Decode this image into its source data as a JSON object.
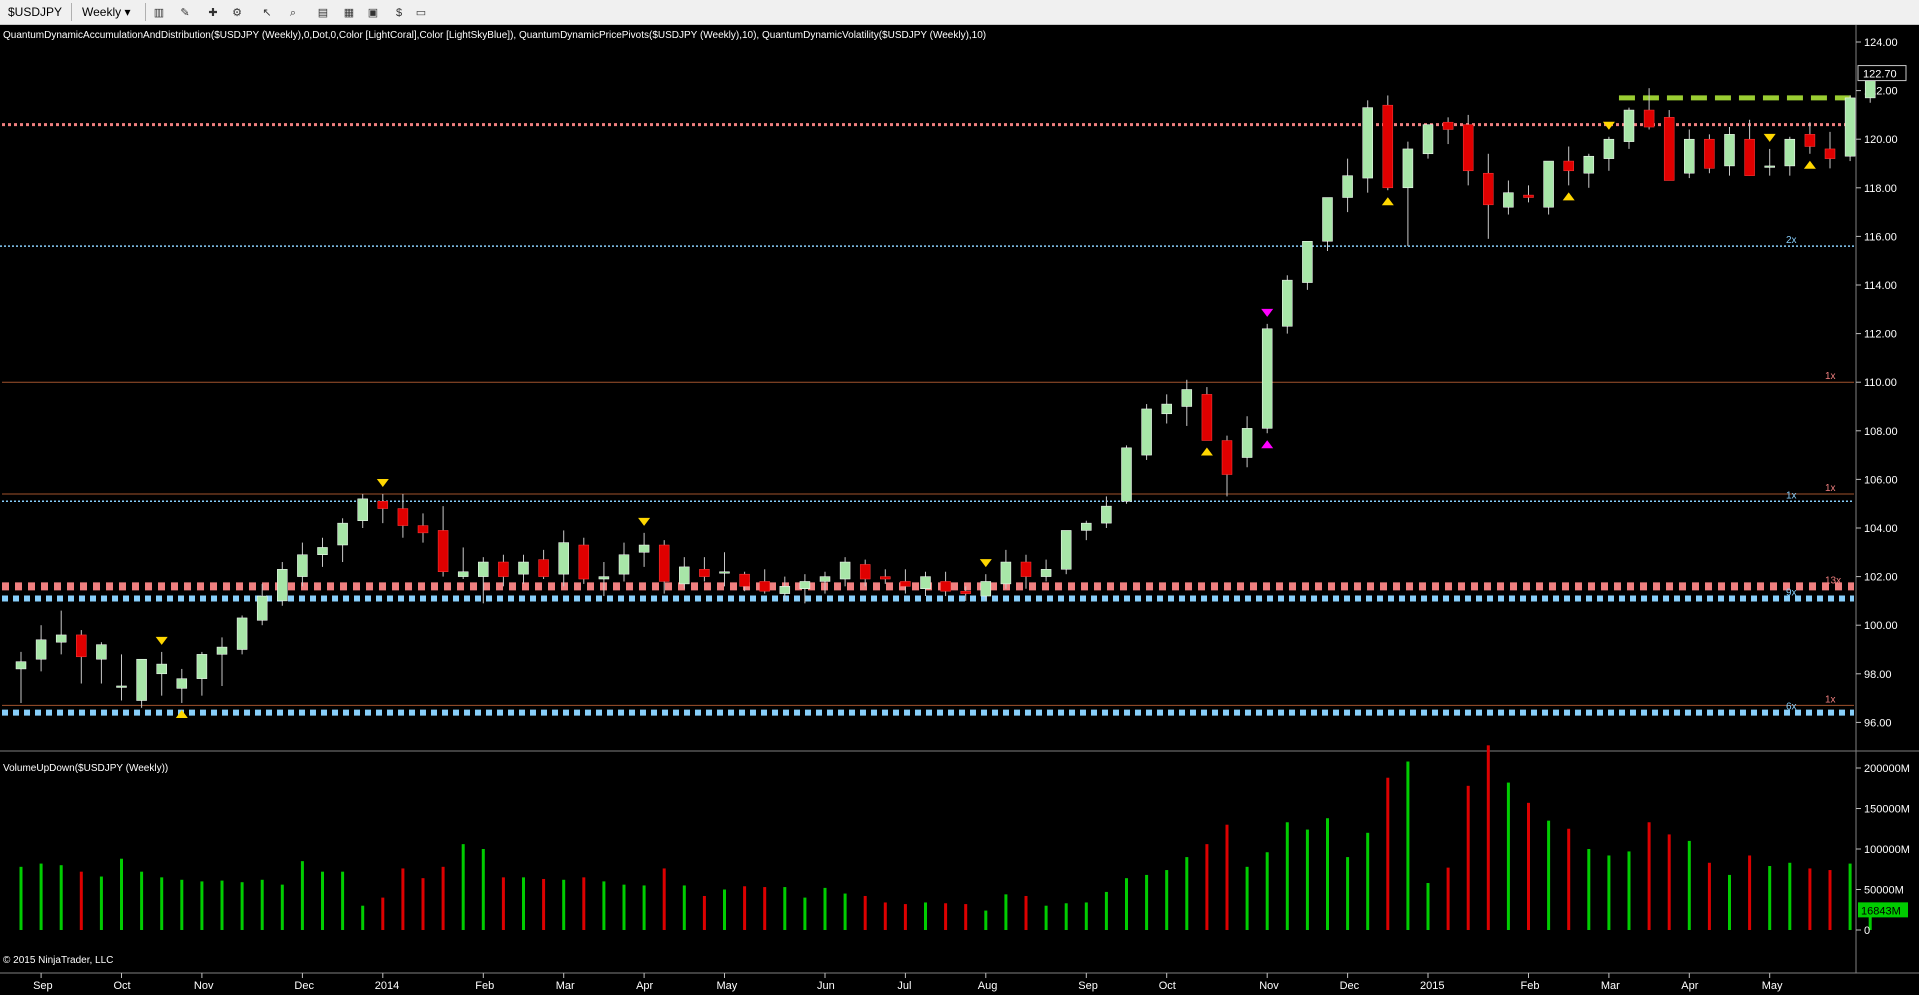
{
  "toolbar": {
    "instrument": "$USDJPY",
    "interval": "Weekly",
    "icons": [
      "bar-style-icon",
      "draw-pencil-icon",
      "indicator-icon",
      "strategy-icon",
      "cursor-icon",
      "zoom-icon",
      "data-box-icon",
      "chart-trader-icon",
      "properties-icon",
      "price-marker-icon",
      "window-icon"
    ]
  },
  "indicator_label": "QuantumDynamicAccumulationAndDistribution($USDJPY (Weekly),0,Dot,0,Color [LightCoral],Color [LightSkyBlue]), QuantumDynamicPricePivots($USDJPY (Weekly),10), QuantumDynamicVolatility($USDJPY (Weekly),10)",
  "volume_label": "VolumeUpDown($USDJPY (Weekly))",
  "copyright": "© 2015 NinjaTrader, LLC",
  "colors": {
    "up": "#a8e6a8",
    "down": "#e00000",
    "vol_up": "#00cc00",
    "vol_down": "#dd0000",
    "coral": "#f08080",
    "skyblue": "#87cefa",
    "pivot": "#ffd700",
    "pivot_alt": "#ff00ff",
    "resistance": "#9acd32"
  },
  "chart_data": [
    {
      "type": "candlestick",
      "title": "$USDJPY Weekly",
      "ylim": [
        94,
        124
      ],
      "y_ticks": [
        "124.00",
        "122.00",
        "120.00",
        "118.00",
        "116.00",
        "114.00",
        "112.00",
        "110.00",
        "108.00",
        "106.00",
        "104.00",
        "102.00",
        "100.00",
        "98.00",
        "96.00"
      ],
      "x_labels": [
        {
          "i": 1,
          "label": "Sep"
        },
        {
          "i": 5,
          "label": "Oct"
        },
        {
          "i": 9,
          "label": "Nov"
        },
        {
          "i": 14,
          "label": "Dec"
        },
        {
          "i": 18,
          "label": "2014"
        },
        {
          "i": 23,
          "label": "Feb"
        },
        {
          "i": 27,
          "label": "Mar"
        },
        {
          "i": 31,
          "label": "Apr"
        },
        {
          "i": 35,
          "label": "May"
        },
        {
          "i": 40,
          "label": "Jun"
        },
        {
          "i": 44,
          "label": "Jul"
        },
        {
          "i": 48,
          "label": "Aug"
        },
        {
          "i": 53,
          "label": "Sep"
        },
        {
          "i": 57,
          "label": "Oct"
        },
        {
          "i": 62,
          "label": "Nov"
        },
        {
          "i": 66,
          "label": "Dec"
        },
        {
          "i": 70,
          "label": "2015"
        },
        {
          "i": 75,
          "label": "Feb"
        },
        {
          "i": 79,
          "label": "Mar"
        },
        {
          "i": 83,
          "label": "Apr"
        },
        {
          "i": 87,
          "label": "May"
        }
      ],
      "candles": [
        [
          98.2,
          98.9,
          96.8,
          98.5
        ],
        [
          98.6,
          100.0,
          98.1,
          99.4
        ],
        [
          99.3,
          100.6,
          98.8,
          99.6
        ],
        [
          99.6,
          99.8,
          97.6,
          98.7
        ],
        [
          98.6,
          99.3,
          97.6,
          99.2
        ],
        [
          97.5,
          98.8,
          96.9,
          97.5
        ],
        [
          96.9,
          98.6,
          96.6,
          98.6
        ],
        [
          98.0,
          98.9,
          97.1,
          98.4
        ],
        [
          97.4,
          98.2,
          96.8,
          97.8
        ],
        [
          97.8,
          98.9,
          97.1,
          98.8
        ],
        [
          98.8,
          99.5,
          97.5,
          99.1
        ],
        [
          99.0,
          100.4,
          98.8,
          100.3
        ],
        [
          100.2,
          101.7,
          100.0,
          101.2
        ],
        [
          101.0,
          102.6,
          100.8,
          102.3
        ],
        [
          102.0,
          103.4,
          101.6,
          102.9
        ],
        [
          102.9,
          103.6,
          102.4,
          103.2
        ],
        [
          103.3,
          104.4,
          102.6,
          104.2
        ],
        [
          104.3,
          105.4,
          104.0,
          105.2
        ],
        [
          105.1,
          105.4,
          104.2,
          104.8
        ],
        [
          104.8,
          105.4,
          103.6,
          104.1
        ],
        [
          104.1,
          104.6,
          103.4,
          103.8
        ],
        [
          103.9,
          104.9,
          102.0,
          102.2
        ],
        [
          102.0,
          103.2,
          101.9,
          102.2
        ],
        [
          102.0,
          102.8,
          100.9,
          102.6
        ],
        [
          102.6,
          102.9,
          101.6,
          102.0
        ],
        [
          102.1,
          102.9,
          101.7,
          102.6
        ],
        [
          102.7,
          103.1,
          101.9,
          102.0
        ],
        [
          102.1,
          103.9,
          101.6,
          103.4
        ],
        [
          103.3,
          103.6,
          101.7,
          101.9
        ],
        [
          101.9,
          102.6,
          101.2,
          102.0
        ],
        [
          102.1,
          103.4,
          101.8,
          102.9
        ],
        [
          103.0,
          103.8,
          102.4,
          103.3
        ],
        [
          103.3,
          103.5,
          101.3,
          101.8
        ],
        [
          101.7,
          102.8,
          101.5,
          102.4
        ],
        [
          102.3,
          102.8,
          101.8,
          102.0
        ],
        [
          102.2,
          103.0,
          101.6,
          102.2
        ],
        [
          102.1,
          102.2,
          101.4,
          101.6
        ],
        [
          101.8,
          102.3,
          101.3,
          101.4
        ],
        [
          101.3,
          102.0,
          101.0,
          101.6
        ],
        [
          101.5,
          102.1,
          100.9,
          101.8
        ],
        [
          101.8,
          102.2,
          101.3,
          102.0
        ],
        [
          101.9,
          102.8,
          101.6,
          102.6
        ],
        [
          102.5,
          102.7,
          101.6,
          101.9
        ],
        [
          102.0,
          102.3,
          101.7,
          101.9
        ],
        [
          101.8,
          102.3,
          101.3,
          101.6
        ],
        [
          101.5,
          102.2,
          101.2,
          102.0
        ],
        [
          101.8,
          102.2,
          101.2,
          101.4
        ],
        [
          101.4,
          101.6,
          101.0,
          101.3
        ],
        [
          101.2,
          102.1,
          101.0,
          101.8
        ],
        [
          101.7,
          103.1,
          101.5,
          102.6
        ],
        [
          102.6,
          102.9,
          101.5,
          102.0
        ],
        [
          102.0,
          102.7,
          101.8,
          102.3
        ],
        [
          102.3,
          103.6,
          102.1,
          103.9
        ],
        [
          103.9,
          104.3,
          103.5,
          104.2
        ],
        [
          104.2,
          105.3,
          104.0,
          104.9
        ],
        [
          105.1,
          107.4,
          105.0,
          107.3
        ],
        [
          107.0,
          109.1,
          106.8,
          108.9
        ],
        [
          108.7,
          109.5,
          108.3,
          109.1
        ],
        [
          109.0,
          110.1,
          108.2,
          109.7
        ],
        [
          109.5,
          109.8,
          107.6,
          107.6
        ],
        [
          107.6,
          107.8,
          105.3,
          106.2
        ],
        [
          106.9,
          108.6,
          106.5,
          108.1
        ],
        [
          108.1,
          112.4,
          107.9,
          112.2
        ],
        [
          112.3,
          114.4,
          112.0,
          114.2
        ],
        [
          114.1,
          115.5,
          113.8,
          115.8
        ],
        [
          115.8,
          117.2,
          115.4,
          117.6
        ],
        [
          117.6,
          119.2,
          117.0,
          118.5
        ],
        [
          118.4,
          121.6,
          117.8,
          121.3
        ],
        [
          121.4,
          121.8,
          117.9,
          118.0
        ],
        [
          118.0,
          119.9,
          115.6,
          119.6
        ],
        [
          119.4,
          120.6,
          119.2,
          120.6
        ],
        [
          120.7,
          120.9,
          119.8,
          120.4
        ],
        [
          120.6,
          121.0,
          118.1,
          118.7
        ],
        [
          118.6,
          119.4,
          115.9,
          117.3
        ],
        [
          117.2,
          118.3,
          116.9,
          117.8
        ],
        [
          117.7,
          118.1,
          117.4,
          117.6
        ],
        [
          117.2,
          119.0,
          116.9,
          119.1
        ],
        [
          119.1,
          119.7,
          118.1,
          118.7
        ],
        [
          118.6,
          119.4,
          118.0,
          119.3
        ],
        [
          119.2,
          120.1,
          118.7,
          120.0
        ],
        [
          119.9,
          121.3,
          119.6,
          121.2
        ],
        [
          121.2,
          122.1,
          120.4,
          120.5
        ],
        [
          120.9,
          121.2,
          118.3,
          118.3
        ],
        [
          118.6,
          120.4,
          118.4,
          120.0
        ],
        [
          120.0,
          120.2,
          118.6,
          118.8
        ],
        [
          118.9,
          120.5,
          118.5,
          120.2
        ],
        [
          120.0,
          120.8,
          118.5,
          118.5
        ],
        [
          118.9,
          119.6,
          118.5,
          118.9
        ],
        [
          118.9,
          120.1,
          118.5,
          120.0
        ],
        [
          120.2,
          120.7,
          119.4,
          119.7
        ],
        [
          119.6,
          120.3,
          118.8,
          119.2
        ],
        [
          119.3,
          121.8,
          119.1,
          121.7
        ],
        [
          121.7,
          122.9,
          121.5,
          122.7
        ]
      ],
      "pivots_high": [
        7,
        18,
        31,
        48,
        62,
        79,
        87
      ],
      "pivots_low": [
        8,
        59,
        68,
        77,
        89
      ],
      "pivot_magenta_high": [
        62
      ],
      "pivot_magenta_low": [
        62
      ],
      "levels": [
        {
          "y": 120.6,
          "style": "coral-dot",
          "label": ""
        },
        {
          "y": 121.7,
          "style": "green-dash",
          "label": ""
        },
        {
          "y": 115.6,
          "style": "blue-thin",
          "label": "2x"
        },
        {
          "y": 110.0,
          "style": "brown-line",
          "label": "1x"
        },
        {
          "y": 105.4,
          "style": "brown-line",
          "label": "1x"
        },
        {
          "y": 105.1,
          "style": "blue-thin",
          "label": "1x"
        },
        {
          "y": 101.6,
          "style": "coral-thick",
          "label": "13x"
        },
        {
          "y": 101.1,
          "style": "blue-thick",
          "label": "9x"
        },
        {
          "y": 96.7,
          "style": "brown-line",
          "label": "1x"
        },
        {
          "y": 96.4,
          "style": "blue-thick",
          "label": "6x"
        }
      ],
      "last_price": "122.70"
    },
    {
      "type": "bar",
      "title": "VolumeUpDown($USDJPY (Weekly))",
      "ylim": [
        0,
        240000
      ],
      "y_ticks": [
        "200000M",
        "150000M",
        "100000M",
        "50000M",
        "0"
      ],
      "values": [
        78000,
        82000,
        80000,
        72000,
        66000,
        88000,
        72000,
        65000,
        62000,
        60000,
        61000,
        59000,
        62000,
        56000,
        85000,
        72000,
        72000,
        30000,
        40000,
        76000,
        64000,
        78000,
        106000,
        100000,
        65000,
        65000,
        63000,
        62000,
        65000,
        60000,
        56000,
        55000,
        76000,
        55000,
        42000,
        50000,
        54000,
        53000,
        53000,
        40000,
        52000,
        45000,
        42000,
        34000,
        32000,
        34000,
        33000,
        32000,
        24000,
        44000,
        42000,
        30000,
        33000,
        34000,
        47000,
        64000,
        68000,
        74000,
        90000,
        106000,
        130000,
        78000,
        96000,
        133000,
        124000,
        138000,
        90000,
        120000,
        188000,
        208000,
        58000,
        77000,
        178000,
        228000,
        182000,
        157000,
        135000,
        125000,
        100000,
        92000,
        97000,
        133000,
        118000,
        110000,
        83000,
        68000,
        92000,
        79000,
        83000,
        76000,
        74000,
        82000,
        16843
      ],
      "last_value": "16843M"
    }
  ]
}
